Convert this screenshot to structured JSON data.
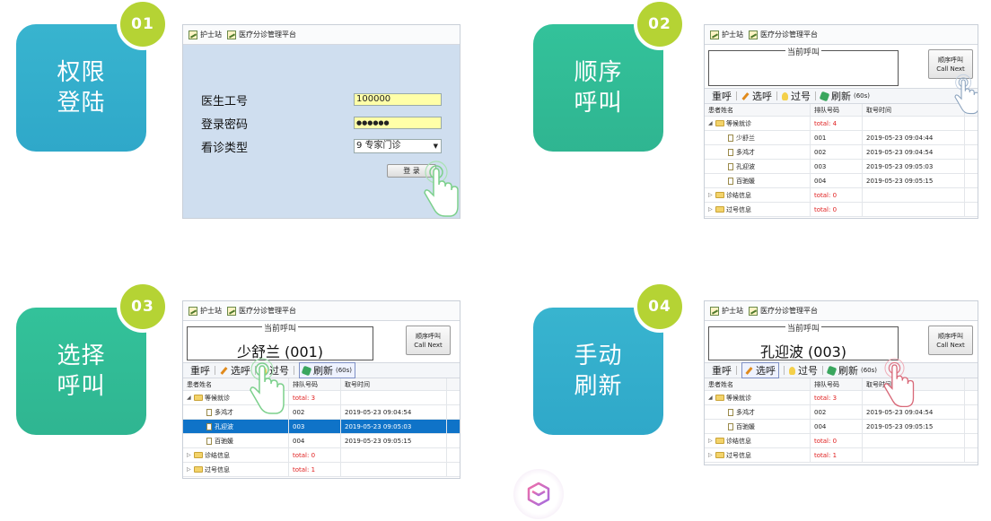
{
  "steps": [
    {
      "badge": "01",
      "title_line1": "权限",
      "title_line2": "登陆"
    },
    {
      "badge": "02",
      "title_line1": "顺序",
      "title_line2": "呼叫"
    },
    {
      "badge": "03",
      "title_line1": "选择",
      "title_line2": "呼叫"
    },
    {
      "badge": "04",
      "title_line1": "手动",
      "title_line2": "刷新"
    }
  ],
  "toolbar": {
    "nurse_station": "护士站",
    "platform": "医疗分诊管理平台"
  },
  "login": {
    "doctor_id_label": "医生工号",
    "doctor_id_value": "100000",
    "password_label": "登录密码",
    "password_value": "●●●●●●",
    "visit_type_label": "看诊类型",
    "visit_type_value": "9 专家门诊",
    "login_button": "登 录"
  },
  "call": {
    "current_legend": "当前呼叫",
    "call_next_cn": "顺序呼叫",
    "call_next_en": "Call Next",
    "recall": "重呼",
    "select": "选呼",
    "skip": "过号",
    "refresh": "刷新",
    "refresh_interval": "(60s)",
    "col_name": "患者姓名",
    "col_queue": "排队号码",
    "col_time": "取号时间",
    "group_waiting": "等候就诊",
    "group_done": "诊结信息",
    "group_skipped": "过号信息"
  },
  "panel2": {
    "current_patient": "",
    "waiting_total": "total: 4",
    "rows": [
      {
        "name": "少舒兰",
        "queue": "001",
        "time": "2019-05-23 09:04:44"
      },
      {
        "name": "多鸿才",
        "queue": "002",
        "time": "2019-05-23 09:04:54"
      },
      {
        "name": "孔迎波",
        "queue": "003",
        "time": "2019-05-23 09:05:03"
      },
      {
        "name": "百驰媛",
        "queue": "004",
        "time": "2019-05-23 09:05:15"
      }
    ],
    "done_total": "total: 0",
    "skipped_total": "total: 0"
  },
  "panel3": {
    "current_patient": "少舒兰 (001)",
    "waiting_total": "total: 3",
    "rows": [
      {
        "name": "多鸿才",
        "queue": "002",
        "time": "2019-05-23 09:04:54"
      },
      {
        "name": "孔迎波",
        "queue": "003",
        "time": "2019-05-23 09:05:03"
      },
      {
        "name": "百驰媛",
        "queue": "004",
        "time": "2019-05-23 09:05:15"
      }
    ],
    "done_total": "total: 0",
    "skipped_total": "total: 1"
  },
  "panel4": {
    "current_patient": "孔迎波 (003)",
    "waiting_total": "total: 3",
    "rows": [
      {
        "name": "多鸿才",
        "queue": "002",
        "time": "2019-05-23 09:04:54"
      },
      {
        "name": "百驰媛",
        "queue": "004",
        "time": "2019-05-23 09:05:15"
      }
    ],
    "done_total": "total: 0",
    "skipped_total": "total: 1"
  },
  "colors": {
    "teal": "#38b4cf",
    "green": "#33c29a",
    "badge": "#b5d334",
    "selected_row": "#0f73c8",
    "login_bg": "#cfdeef"
  }
}
